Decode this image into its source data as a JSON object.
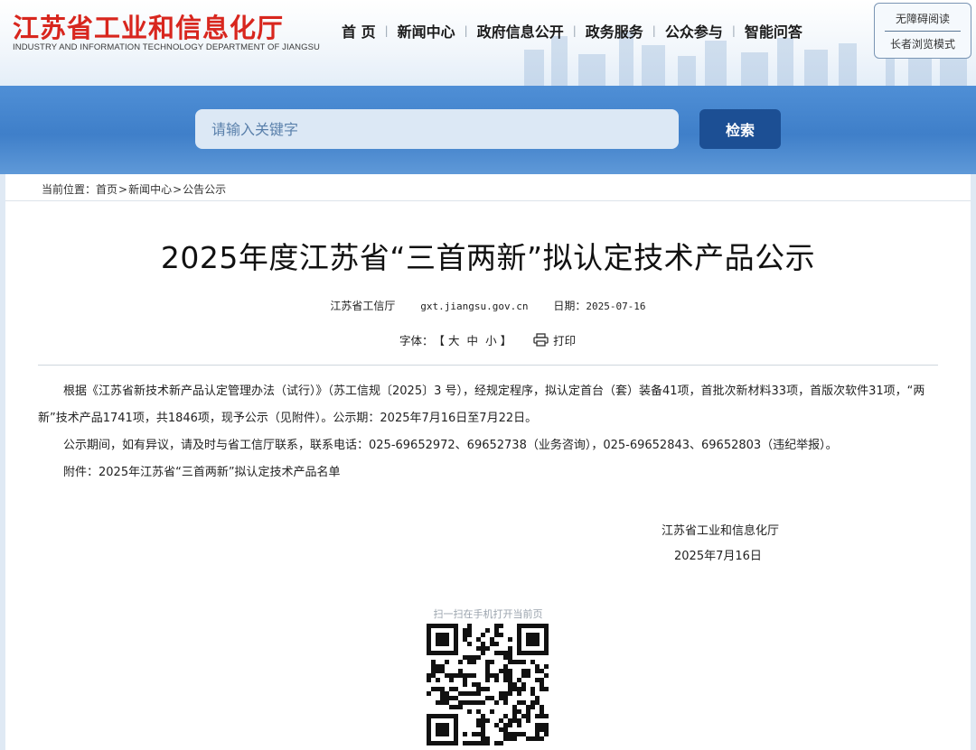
{
  "header": {
    "logo_cn": "江苏省工业和信息化厅",
    "logo_en": "INDUSTRY AND INFORMATION TECHNOLOGY DEPARTMENT OF JIANGSU",
    "nav": [
      "首 页",
      "新闻中心",
      "政府信息公开",
      "政务服务",
      "公众参与",
      "智能问答"
    ],
    "accessibility": {
      "barrier_free": "无障碍阅读",
      "elderly_mode": "长者浏览模式"
    }
  },
  "search": {
    "placeholder": "请输入关键字",
    "button": "检索"
  },
  "breadcrumb": {
    "label": "当前位置：",
    "items": [
      "首页",
      "新闻中心",
      "公告公示"
    ],
    "sep": ">"
  },
  "article": {
    "title": "2025年度江苏省“三首两新”拟认定技术产品公示",
    "source": "江苏省工信厅",
    "site": "gxt.jiangsu.gov.cn",
    "date_label": "日期：",
    "date": "2025-07-16",
    "font_label": "字体：",
    "font_open": "【",
    "font_sizes": [
      "大",
      "中",
      "小"
    ],
    "font_close": "】",
    "print": "打印",
    "paragraphs": [
      "根据《江苏省新技术新产品认定管理办法（试行）》（苏工信规〔2025〕3 号），经规定程序，拟认定首台（套）装备41项，首批次新材料33项，首版次软件31项，“两新”技术产品1741项，共1846项，现予公示（见附件）。公示期：2025年7月16日至7月22日。",
      "公示期间，如有异议，请及时与省工信厅联系，联系电话：025-69652972、69652738（业务咨询），025-69652843、69652803（违纪举报）。",
      "附件：2025年江苏省“三首两新”拟认定技术产品名单"
    ],
    "signature_org": "江苏省工业和信息化厅",
    "signature_date": "2025年7月16日"
  },
  "qr": {
    "label": "扫一扫在手机打开当前页"
  },
  "colors": {
    "brand_red": "#d8261e",
    "band_blue": "#3f7fc9",
    "button_blue": "#1c4f94"
  },
  "icons": {
    "print": "printer-icon",
    "qr": "qr-code-icon"
  }
}
